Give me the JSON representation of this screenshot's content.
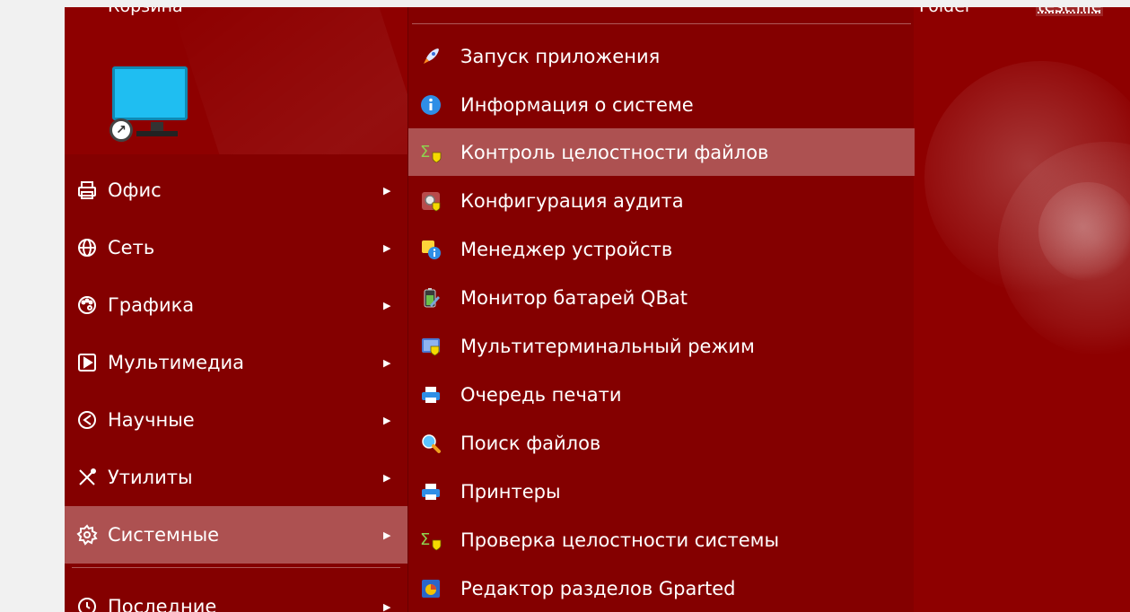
{
  "desktop": {
    "trash_label": "Корзина",
    "folder_label": "Folder",
    "file_label": "test.file"
  },
  "main_menu": {
    "items": [
      {
        "label": "Офис",
        "icon": "printer-outline-icon"
      },
      {
        "label": "Сеть",
        "icon": "globe-icon"
      },
      {
        "label": "Графика",
        "icon": "palette-icon"
      },
      {
        "label": "Мультимедиа",
        "icon": "play-icon"
      },
      {
        "label": "Научные",
        "icon": "science-icon"
      },
      {
        "label": "Утилиты",
        "icon": "tools-icon"
      },
      {
        "label": "Системные",
        "icon": "gear-icon",
        "active": true
      },
      {
        "label": "Последние",
        "icon": "history-icon"
      }
    ]
  },
  "sub_menu": {
    "items": [
      {
        "label": "Запуск приложения",
        "icon": "rocket-icon"
      },
      {
        "label": "Информация о системе",
        "icon": "info-icon"
      },
      {
        "label": "Контроль целостности файлов",
        "icon": "sigma-shield-icon",
        "active": true
      },
      {
        "label": "Конфигурация аудита",
        "icon": "audit-gear-icon"
      },
      {
        "label": "Менеджер устройств",
        "icon": "device-manager-icon"
      },
      {
        "label": "Монитор батарей QBat",
        "icon": "battery-icon"
      },
      {
        "label": "Мультитерминальный режим",
        "icon": "multiterminal-icon"
      },
      {
        "label": "Очередь печати",
        "icon": "printer-icon"
      },
      {
        "label": "Поиск файлов",
        "icon": "magnifier-icon"
      },
      {
        "label": "Принтеры",
        "icon": "printer-icon"
      },
      {
        "label": "Проверка целостности системы",
        "icon": "sigma-shield-icon"
      },
      {
        "label": "Редактор разделов Gparted",
        "icon": "gparted-icon"
      }
    ]
  },
  "colors": {
    "menu_bg": "#840000",
    "active_bg": "#ad5151",
    "wallpaper": "#8e0000",
    "text": "#ffffff"
  }
}
